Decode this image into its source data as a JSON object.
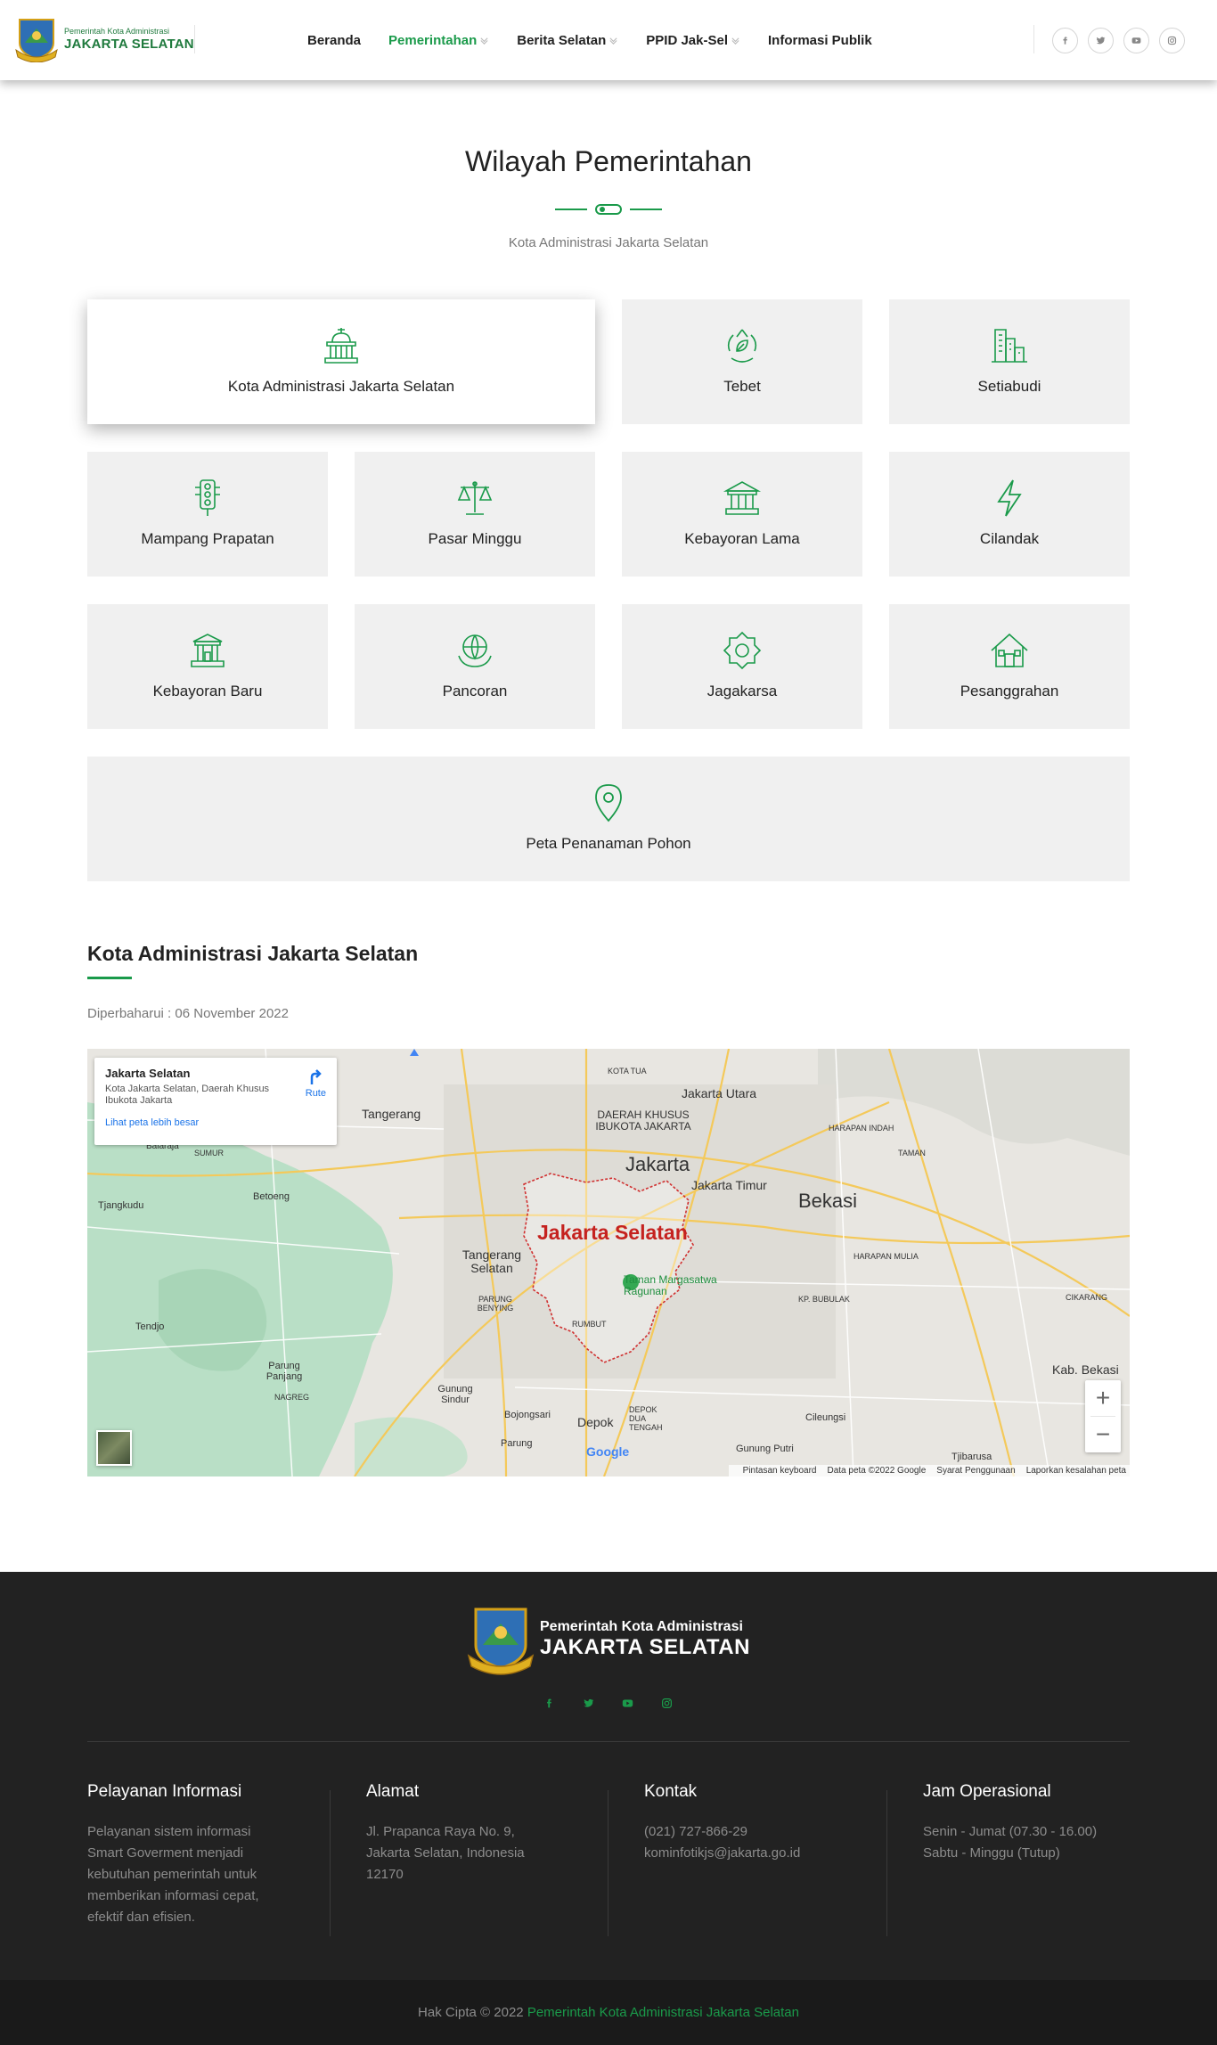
{
  "header": {
    "logo_small": "Pemerintah Kota Administrasi",
    "logo_big": "JAKARTA SELATAN",
    "nav": [
      {
        "label": "Beranda",
        "dropdown": false,
        "active": false
      },
      {
        "label": "Pemerintahan",
        "dropdown": true,
        "active": true
      },
      {
        "label": "Berita Selatan",
        "dropdown": true,
        "active": false
      },
      {
        "label": "PPID Jak-Sel",
        "dropdown": true,
        "active": false
      },
      {
        "label": "Informasi Publik",
        "dropdown": false,
        "active": false
      }
    ],
    "socials": [
      "facebook-icon",
      "twitter-icon",
      "youtube-icon",
      "instagram-icon"
    ]
  },
  "section": {
    "title": "Wilayah Pemerintahan",
    "subtitle": "Kota Administrasi Jakarta Selatan"
  },
  "cards": [
    {
      "label": "Kota Administrasi Jakarta Selatan",
      "icon": "city-hall-icon",
      "featured": true
    },
    {
      "label": "Tebet",
      "icon": "recycle-leaf-icon"
    },
    {
      "label": "Setiabudi",
      "icon": "skyscraper-icon"
    },
    {
      "label": "Mampang Prapatan",
      "icon": "traffic-light-icon"
    },
    {
      "label": "Pasar Minggu",
      "icon": "scale-icon"
    },
    {
      "label": "Kebayoran Lama",
      "icon": "bank-building-icon"
    },
    {
      "label": "Cilandak",
      "icon": "lightning-icon"
    },
    {
      "label": "Kebayoran Baru",
      "icon": "museum-icon"
    },
    {
      "label": "Pancoran",
      "icon": "globe-hands-icon"
    },
    {
      "label": "Jagakarsa",
      "icon": "badge-icon"
    },
    {
      "label": "Pesanggrahan",
      "icon": "house-icon"
    },
    {
      "label": "Peta Penanaman Pohon",
      "icon": "map-pin-icon"
    }
  ],
  "info": {
    "title": "Kota Administrasi Jakarta Selatan",
    "updated": "Diperbaharui : 06 November 2022"
  },
  "map": {
    "place_title": "Jakarta Selatan",
    "place_address": "Kota Jakarta Selatan, Daerah Khusus Ibukota Jakarta",
    "larger_map_link": "Lihat peta lebih besar",
    "route_label": "Rute",
    "highlight_label": "Jakarta Selatan",
    "zoom_in": "+",
    "zoom_out": "−",
    "google": "Google",
    "footer": [
      "Pintasan keyboard",
      "Data peta ©2022 Google",
      "Syarat Penggunaan",
      "Laporkan kesalahan peta"
    ],
    "labels": {
      "tangerang": "Tangerang",
      "jakarta": "Jakarta",
      "jakarta_utara": "Jakarta Utara",
      "jakarta_timur": "Jakarta Timur",
      "bekasi": "Bekasi",
      "tangerang_selatan": "Tangerang Selatan",
      "depok": "Depok",
      "kab_bekasi": "Kab. Bekasi",
      "dki": "DAERAH KHUSUS IBUKOTA JAKARTA",
      "taman": "Taman Margasatwa Ragunan",
      "tjangkudu": "Tjangkudu",
      "betoeng": "Betoeng",
      "tendjo": "Tendjo",
      "parung_panjang": "Parung Panjang",
      "nagreg": "NAGREG",
      "gunung_sindur": "Gunung Sindur",
      "bojongsari": "Bojongsari",
      "parung": "Parung",
      "cileungsi": "Cileungsi",
      "gunung_putri": "Gunung Putri",
      "tjibarusa": "Tjibarusa",
      "cikarang": "CIKARANG",
      "harapan_mulia": "HARAPAN MULIA",
      "kp_bubulak": "KP. BUBULAK",
      "harapan_indah": "HARAPAN INDAH",
      "taman_lbl": "TAMAN",
      "kota_tua": "KOTA TUA",
      "parung_benying": "PARUNG BENYING",
      "rumbut": "RUMBUT",
      "depok_dua": "DEPOK DUA TENGAH",
      "balaraja": "Balaraja",
      "sumur": "SUMUR"
    }
  },
  "footer": {
    "logo_small": "Pemerintah Kota Administrasi",
    "logo_big": "JAKARTA SELATAN",
    "socials": [
      "facebook-icon",
      "twitter-icon",
      "youtube-icon",
      "instagram-icon"
    ],
    "columns": [
      {
        "title": "Pelayanan Informasi",
        "lines": [
          "Pelayanan sistem informasi",
          "Smart Goverment menjadi",
          "kebutuhan pemerintah untuk",
          "memberikan informasi cepat,",
          "efektif dan efisien."
        ]
      },
      {
        "title": "Alamat",
        "lines": [
          "Jl. Prapanca Raya No. 9,",
          "Jakarta Selatan, Indonesia",
          "12170"
        ]
      },
      {
        "title": "Kontak",
        "lines": [
          "(021) 727-866-29",
          "kominfotikjs@jakarta.go.id"
        ]
      },
      {
        "title": "Jam Operasional",
        "lines": [
          "Senin - Jumat (07.30 - 16.00)",
          "Sabtu - Minggu (Tutup)"
        ]
      }
    ],
    "copyright_prefix": "Hak Cipta © 2022 ",
    "copyright_link": "Pemerintah Kota Administrasi Jakarta Selatan"
  },
  "colors": {
    "accent": "#1a9a4a",
    "card_bg": "#f0f0f0",
    "footer_bg": "#222222",
    "copyright_bg": "#1a1a1a"
  }
}
